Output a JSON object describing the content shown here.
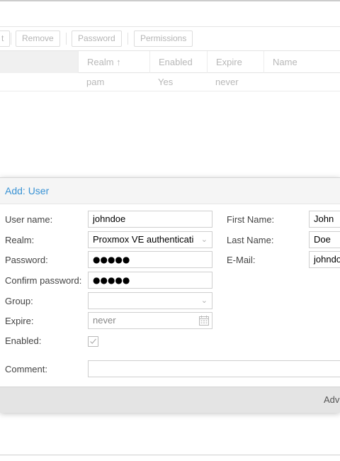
{
  "toolbar": {
    "edit_fragment": "t",
    "remove": "Remove",
    "password": "Password",
    "permissions": "Permissions"
  },
  "grid": {
    "columns": [
      "Realm ↑",
      "Enabled",
      "Expire",
      "Name"
    ],
    "rows": [
      {
        "realm": "pam",
        "enabled": "Yes",
        "expire": "never",
        "name": ""
      }
    ]
  },
  "dialog": {
    "title": "Add: User",
    "labels": {
      "username": "User name:",
      "realm": "Realm:",
      "password": "Password:",
      "confirm_password": "Confirm password:",
      "group": "Group:",
      "expire": "Expire:",
      "enabled": "Enabled:",
      "comment": "Comment:",
      "first_name": "First Name:",
      "last_name": "Last Name:",
      "email": "E-Mail:"
    },
    "values": {
      "username": "johndoe",
      "realm": "Proxmox VE authenticati",
      "password": "●●●●●",
      "confirm_password": "●●●●●",
      "group": "",
      "expire": "never",
      "enabled": true,
      "comment": "",
      "first_name": "John",
      "last_name": "Doe",
      "email": "johndo"
    },
    "footer": {
      "advanced": "Adv"
    }
  },
  "colors": {
    "title_accent": "#3892d4",
    "dim_text": "#b8b8b8"
  },
  "icons": {
    "combo": "chevron-down-icon",
    "calendar": "calendar-icon",
    "checkbox": "checkmark-icon"
  }
}
